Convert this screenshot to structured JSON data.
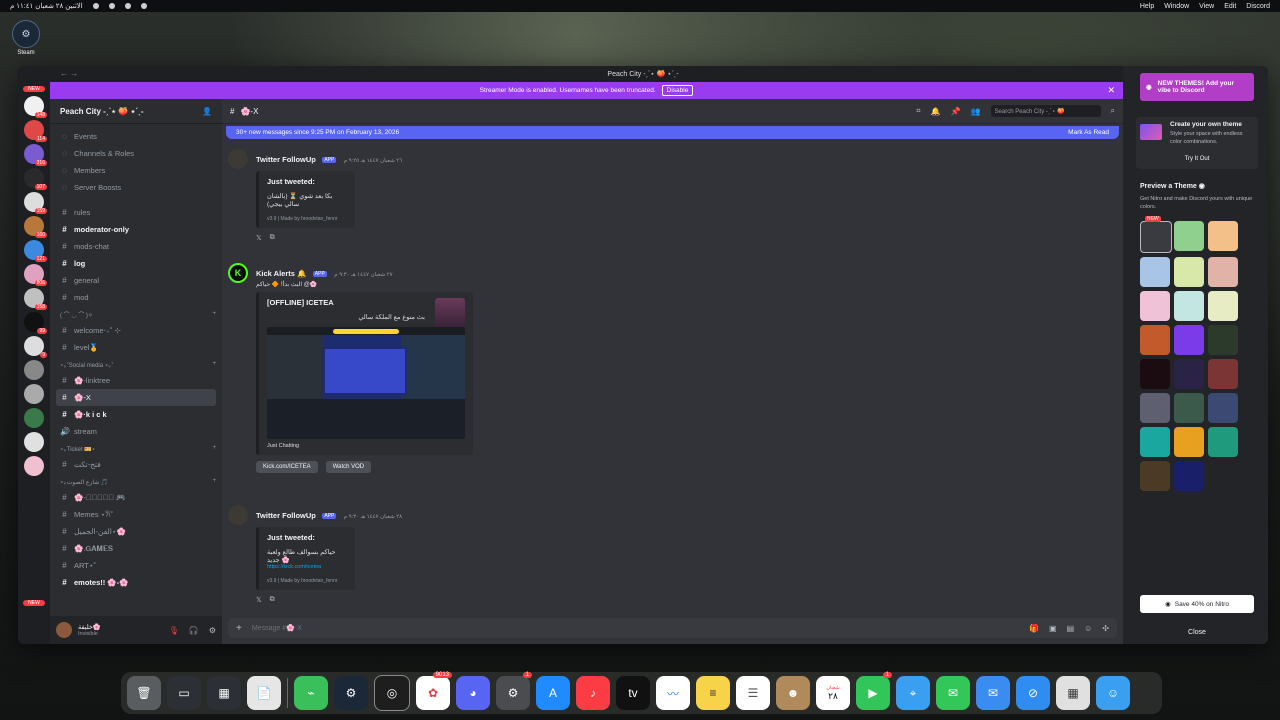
{
  "menubar": {
    "left_date": "الاثنين ٢٨ شعبان ١١:٤١ م",
    "right_items": [
      "Help",
      "Window",
      "View",
      "Edit",
      "Discord"
    ]
  },
  "desktop": {
    "steam_label": "Steam"
  },
  "window": {
    "title": "Peach City -ˏˋ⋆ 🍑 ⋆ˊˎ-"
  },
  "banner": {
    "text": "Streamer Mode is enabled. Usernames have been truncated.",
    "button": "Disable"
  },
  "rail": {
    "new_top": "NEW",
    "new_bottom": "NEW",
    "badges": [
      "148",
      "114",
      "316",
      "107",
      "159",
      "160",
      "121",
      "806",
      "158",
      "99",
      "9"
    ]
  },
  "server": {
    "name": "Peach City -ˏˋ⋆ 🍑 ⋆ˊˎ-",
    "menu": [
      "Events",
      "Channels & Roles",
      "Members",
      "Server Boosts"
    ],
    "channels": [
      {
        "name": "rules",
        "icon": "#",
        "style": ""
      },
      {
        "name": "moderator-only",
        "icon": "#",
        "style": "bright"
      },
      {
        "name": "mods-chat",
        "icon": "#",
        "style": ""
      },
      {
        "name": "log",
        "icon": "#",
        "style": "bright"
      },
      {
        "name": "general",
        "icon": "#",
        "style": ""
      },
      {
        "name": "mod",
        "icon": "#",
        "style": ""
      }
    ],
    "cat1": "( ⌒ ◡ ⌒ )✧",
    "channels2": [
      {
        "name": "welcome‧₊˚ ⊹",
        "icon": "#"
      },
      {
        "name": "level🏅",
        "icon": "#"
      }
    ],
    "cat2": "⋆｡˚Social media ⋆｡˚",
    "channels3": [
      {
        "name": "🌸-linktree",
        "icon": "#",
        "style": ""
      },
      {
        "name": "🌸-X",
        "icon": "#",
        "style": "active"
      },
      {
        "name": "🌸·k i c k",
        "icon": "#",
        "style": "bright"
      },
      {
        "name": "stream",
        "icon": "🔊",
        "style": ""
      }
    ],
    "cat3": "⋆｡Ticket 🎫⋆",
    "channels4": [
      {
        "name": "فتح-تكت",
        "icon": "#"
      }
    ],
    "cat4": "⋆｡شارع الصوت 🎵",
    "channels5": [
      {
        "name": "🌸-ﾟ𝐏𝐨𝐨𝐥 🎮",
        "icon": "#",
        "style": ""
      },
      {
        "name": "Memes ⋆𐙚˚",
        "icon": "#",
        "style": ""
      },
      {
        "name": "الفن-الجميل⋆🌸",
        "icon": "#",
        "style": ""
      },
      {
        "name": "🌸.𝐆𝐀𝐌𝐄𝐒",
        "icon": "#",
        "style": ""
      },
      {
        "name": "ART⋆˚",
        "icon": "#",
        "style": ""
      },
      {
        "name": "emotes!! 🌸-🌸",
        "icon": "#",
        "style": "bright"
      }
    ]
  },
  "user": {
    "name": "خليفة🌸",
    "status": "Invisible"
  },
  "chat": {
    "channel": "🌸-X",
    "search_placeholder": "Search Peach City -ˏˋ⋆ 🍑",
    "new_messages": "30+ new messages since 9:25 PM on February 13, 2026",
    "mark_read": "Mark As Read",
    "composer_placeholder": "Message #🌸-X"
  },
  "messages": [
    {
      "author": "Twitter FollowUp",
      "app": "APP",
      "time": "٢٦ شعبان ١٤٤٧ هـ ٩:٢٥ م",
      "embed_title": "Just tweeted:",
      "embed_text": "بكا بعد شوي ⏳ (بالشان سالي بيجي)",
      "footer": "v3.9 | Made by hroodvtan_fennr"
    },
    {
      "author": "Kick Alerts 🔔",
      "app": "APP",
      "time": "٢٧ شعبان ١٤٤٧ هـ ٩:٣٠ م",
      "mention": "البث بدأ! 🔶 حياكم @🌸",
      "embed_title": "[OFFLINE] ICETEA",
      "embed_text": "بث منوع مع الملكة سالي",
      "caption": "Just Chatting",
      "link_label": "Kick.com/ICETEA",
      "watch_label": "Watch VOD"
    },
    {
      "author": "Twitter FollowUp",
      "app": "APP",
      "time": "٢٨ شعبان ١٤٤٧ هـ ٩:٣٠ م",
      "embed_title": "Just tweeted:",
      "embed_text": "حياكم بسوالف طالع ولعبة جديد 🌸",
      "embed_link": "https://kick.com/icetea",
      "footer": "v3.9 | Made by hroodvtan_fennr"
    }
  ],
  "nitro": {
    "promo": "NEW THEMES! Add your vibe to Discord",
    "create_title": "Create your own theme",
    "create_desc": "Style your space with endless color combinations.",
    "try": "Try It Out",
    "preview_title": "Preview a Theme",
    "preview_sub": "Get Nitro and make Discord yours with unique colors.",
    "new_tag": "NEW",
    "save": "Save 40% on Nitro",
    "close": "Close",
    "swatch_colors": [
      "#3a3b40",
      "#8fd08e",
      "#f3c08a",
      "#a8c4e6",
      "#d7e8a8",
      "#e0b2a8",
      "#f0c2d8",
      "#c4e6e2",
      "#e8ecc4",
      "#c25a2c",
      "#7b3be8",
      "#2c3a2c",
      "#1a0c10",
      "#2a2346",
      "#7a3534",
      "#5e6072",
      "#3c5a4c",
      "#3a4a72",
      "#1aa7a0",
      "#e8a020",
      "#1f9a7c",
      "#4a3a26",
      "#1a1f6a"
    ]
  },
  "dock": {
    "badge_a": "9013",
    "badge_b": "1",
    "badge_c": "1",
    "calendar_day": "٢٨",
    "calendar_month": "شعبان"
  }
}
